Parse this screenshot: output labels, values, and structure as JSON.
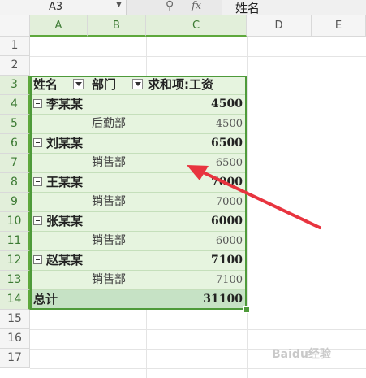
{
  "formula_bar": {
    "name_box": "A3",
    "zoom_icon": "zoom-icon",
    "fx_label": "fx",
    "content": "姓名"
  },
  "columns": [
    "A",
    "B",
    "C",
    "D",
    "E"
  ],
  "rows": [
    "1",
    "2",
    "3",
    "4",
    "5",
    "6",
    "7",
    "8",
    "9",
    "10",
    "11",
    "12",
    "13",
    "14",
    "15",
    "16",
    "17"
  ],
  "pivot": {
    "header": {
      "name": "姓名",
      "dept": "部门",
      "sum": "求和项:工资"
    },
    "lines": [
      {
        "type": "group",
        "name": "李某某",
        "value": "4500"
      },
      {
        "type": "detail",
        "dept": "后勤部",
        "value": "4500"
      },
      {
        "type": "group",
        "name": "刘某某",
        "value": "6500"
      },
      {
        "type": "detail",
        "dept": "销售部",
        "value": "6500"
      },
      {
        "type": "group",
        "name": "王某某",
        "value": "7000"
      },
      {
        "type": "detail",
        "dept": "销售部",
        "value": "7000"
      },
      {
        "type": "group",
        "name": "张某某",
        "value": "6000"
      },
      {
        "type": "detail",
        "dept": "销售部",
        "value": "6000"
      },
      {
        "type": "group",
        "name": "赵某某",
        "value": "7100"
      },
      {
        "type": "detail",
        "dept": "销售部",
        "value": "7100"
      }
    ],
    "total": {
      "label": "总计",
      "value": "31100"
    }
  },
  "arrow_color": "#e8343f",
  "selection_color": "#4e9a3a",
  "watermark": "Baidu经验"
}
